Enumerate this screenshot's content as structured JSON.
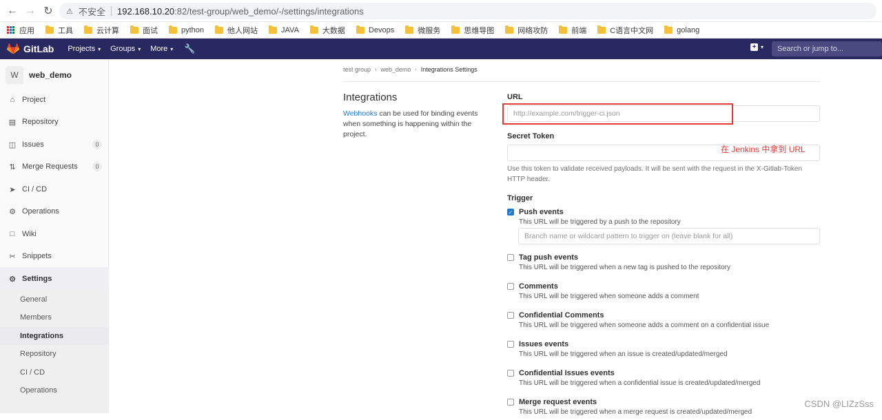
{
  "browser": {
    "security_label": "不安全",
    "url_host": "192.168.10.20",
    "url_path": ":82/test-group/web_demo/-/settings/integrations",
    "bookmarks": [
      "应用",
      "工具",
      "云计算",
      "面试",
      "python",
      "他人网站",
      "JAVA",
      "大数据",
      "Devops",
      "微服务",
      "思维导图",
      "网络攻防",
      "前端",
      "C语言中文网",
      "golang"
    ]
  },
  "navbar": {
    "brand": "GitLab",
    "menus": [
      "Projects",
      "Groups",
      "More"
    ],
    "search_placeholder": "Search or jump to..."
  },
  "sidebar": {
    "project_initial": "W",
    "project_name": "web_demo",
    "items": [
      {
        "label": "Project"
      },
      {
        "label": "Repository"
      },
      {
        "label": "Issues",
        "count": "0"
      },
      {
        "label": "Merge Requests",
        "count": "0"
      },
      {
        "label": "CI / CD"
      },
      {
        "label": "Operations"
      },
      {
        "label": "Wiki"
      },
      {
        "label": "Snippets"
      },
      {
        "label": "Settings"
      }
    ],
    "settings_sub": [
      "General",
      "Members",
      "Integrations",
      "Repository",
      "CI / CD",
      "Operations"
    ]
  },
  "breadcrumb": [
    "test group",
    "web_demo",
    "Integrations Settings"
  ],
  "integrations": {
    "title": "Integrations",
    "desc_link": "Webhooks",
    "desc_rest": " can be used for binding events when something is happening within the project."
  },
  "form": {
    "url_label": "URL",
    "url_placeholder": "http://example.com/trigger-ci.json",
    "token_label": "Secret Token",
    "annotation": "在 Jenkins 中拿到 URL",
    "token_help": "Use this token to validate received payloads. It will be sent with the request in the X-Gitlab-Token HTTP header.",
    "trigger_label": "Trigger",
    "branch_placeholder": "Branch name or wildcard pattern to trigger on (leave blank for all)",
    "triggers": [
      {
        "title": "Push events",
        "desc": "This URL will be triggered by a push to the repository",
        "checked": true
      },
      {
        "title": "Tag push events",
        "desc": "This URL will be triggered when a new tag is pushed to the repository",
        "checked": false
      },
      {
        "title": "Comments",
        "desc": "This URL will be triggered when someone adds a comment",
        "checked": false
      },
      {
        "title": "Confidential Comments",
        "desc": "This URL will be triggered when someone adds a comment on a confidential issue",
        "checked": false
      },
      {
        "title": "Issues events",
        "desc": "This URL will be triggered when an issue is created/updated/merged",
        "checked": false
      },
      {
        "title": "Confidential Issues events",
        "desc": "This URL will be triggered when a confidential issue is created/updated/merged",
        "checked": false
      },
      {
        "title": "Merge request events",
        "desc": "This URL will be triggered when a merge request is created/updated/merged",
        "checked": false
      }
    ]
  },
  "watermark": "CSDN @LIZzSss"
}
